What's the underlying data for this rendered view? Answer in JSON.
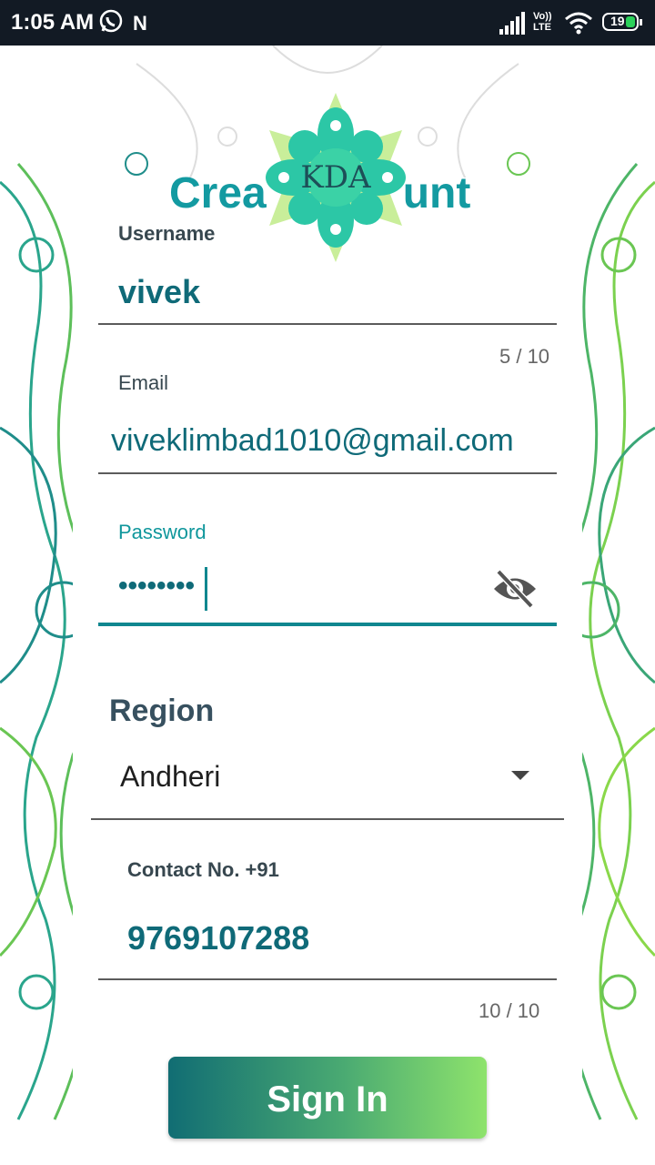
{
  "status_bar": {
    "time": "1:05 AM",
    "n_icon": "N",
    "lte_top": "Vo))",
    "lte_bottom": "LTE",
    "battery_level": "19"
  },
  "header": {
    "title_left": "Crea",
    "title_right": "unt",
    "logo_text": "KDA"
  },
  "form": {
    "username_label": "Username",
    "username_value": "vivek",
    "username_counter": "5 / 10",
    "email_label": "Email",
    "email_value": "viveklimbad1010@gmail.com",
    "password_label": "Password",
    "password_value": "••••••••",
    "region_title": "Region",
    "region_value": "Andheri",
    "contact_label": "Contact No. +91",
    "contact_value": "9769107288",
    "contact_counter": "10 / 10",
    "signin_label": "Sign In"
  },
  "colors": {
    "accent": "#139aa1",
    "value_text": "#0f6a78",
    "button_start": "#116d73",
    "button_end": "#8ee36c"
  }
}
